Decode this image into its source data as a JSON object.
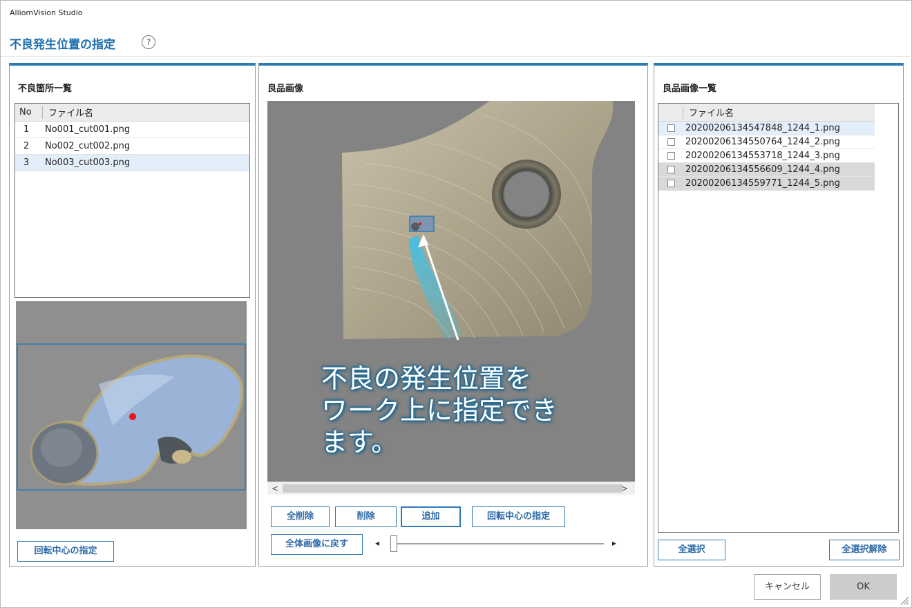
{
  "app": {
    "title": "AlliomVision Studio"
  },
  "dialog": {
    "title": "不良発生位置の指定",
    "help_icon": "?"
  },
  "left_panel": {
    "title": "不良箇所一覧",
    "columns": {
      "no": "No",
      "name": "ファイル名"
    },
    "rows": [
      {
        "no": "1",
        "name": "No001_cut001.png"
      },
      {
        "no": "2",
        "name": "No002_cut002.png"
      },
      {
        "no": "3",
        "name": "No003_cut003.png"
      }
    ],
    "rotation_button": "回転中心の指定"
  },
  "center_panel": {
    "title": "良品画像",
    "overlay_lines": [
      "不良の発生位置を",
      "ワーク上に指定でき",
      "ます。"
    ],
    "buttons": {
      "delete_all": "全削除",
      "delete": "削除",
      "add": "追加",
      "rotation_center": "回転中心の指定",
      "back_to_full": "全体画像に戻す"
    },
    "scroll": {
      "left": "<",
      "right": ">"
    }
  },
  "right_panel": {
    "title": "良品画像一覧",
    "column": "ファイル名",
    "rows": [
      {
        "name": "20200206134547848_1244_1.png",
        "state": "selected"
      },
      {
        "name": "20200206134550764_1244_2.png",
        "state": ""
      },
      {
        "name": "20200206134553718_1244_3.png",
        "state": ""
      },
      {
        "name": "20200206134556609_1244_4.png",
        "state": "checked"
      },
      {
        "name": "20200206134559771_1244_5.png",
        "state": "checked"
      }
    ],
    "select_all": "全選択",
    "deselect_all": "全選択解除"
  },
  "footer": {
    "cancel": "キャンセル",
    "ok": "OK"
  },
  "colors": {
    "accent": "#2a7bb5",
    "title_blue": "#1d6fb0",
    "overlay_glow": "#1f6d99"
  }
}
